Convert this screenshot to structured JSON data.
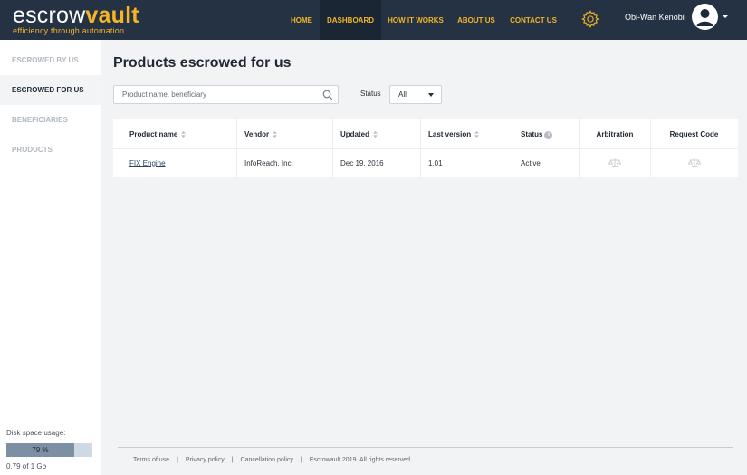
{
  "brand": {
    "name_plain": "escrow",
    "name_accent": "vault",
    "tagline": "efficiency through automation",
    "accent_color": "#f3b428",
    "header_bg": "#243243"
  },
  "nav": {
    "items": [
      {
        "label": "HOME",
        "active": false
      },
      {
        "label": "DASHBOARD",
        "active": true
      },
      {
        "label": "HOW IT WORKS",
        "active": false
      },
      {
        "label": "ABOUT US",
        "active": false
      },
      {
        "label": "CONTACT US",
        "active": false
      }
    ],
    "settings_icon": "gear-icon",
    "user_name": "Obi-Wan Kenobi",
    "avatar_icon": "user-avatar-icon"
  },
  "sidebar": {
    "items": [
      {
        "label": "ESCROWED BY US",
        "active": false
      },
      {
        "label": "ESCROWED FOR US",
        "active": true
      },
      {
        "label": "BENEFICIARIES",
        "active": false
      },
      {
        "label": "PRODUCTS",
        "active": false
      }
    ],
    "disk": {
      "label": "Disk space usage:",
      "percent_text": "79 %",
      "fill_fraction": 0.79,
      "size_text": "0.79 of 1 Gb"
    }
  },
  "main": {
    "title": "Products escrowed for us",
    "search": {
      "placeholder": "Product name, beneficiary",
      "value": ""
    },
    "status_filter": {
      "label": "Status",
      "value": "All"
    },
    "table": {
      "columns": [
        "Product name",
        "Vendor",
        "Updated",
        "Last version",
        "Status",
        "Arbitration",
        "Request Code"
      ],
      "rows": [
        {
          "product": "FIX Engine",
          "vendor": "InfoReach, Inc.",
          "updated": "Dec 19, 2016",
          "version": "1.01",
          "status": "Active",
          "arbitration_icon": "scales-icon",
          "request_icon": "scales-icon"
        }
      ]
    }
  },
  "footer": {
    "terms": "Terms of use",
    "privacy": "Privacy policy",
    "cancellation": "Cancellation policy",
    "copyright": "Escrowault 2019. All rights reserved.",
    "separator": "|"
  }
}
